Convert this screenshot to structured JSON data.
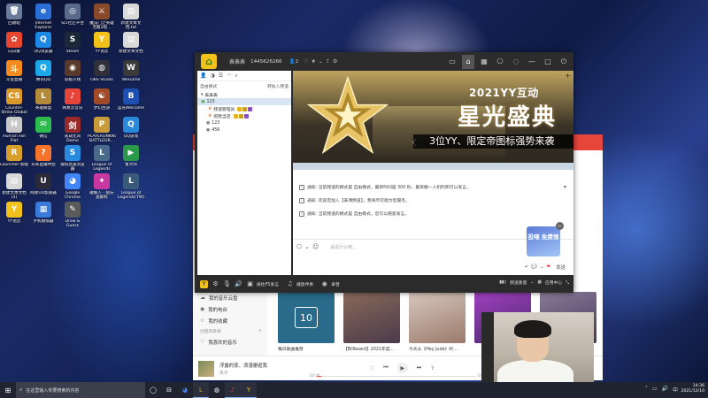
{
  "desktop": {
    "icons": [
      {
        "label": "回收站",
        "glyph": "🗑",
        "color": "#6b7c9a"
      },
      {
        "label": "Internet Explorer",
        "glyph": "e",
        "color": "#2a6fd6"
      },
      {
        "label": "SCI社区平台",
        "glyph": "◎",
        "color": "#5a6a8a"
      },
      {
        "label": "魔法门之英雄无敌3经...",
        "glyph": "⚔",
        "color": "#8a4a2a"
      },
      {
        "label": "新建文本文档.txt",
        "glyph": "▤",
        "color": "#d8d8d8"
      },
      {
        "label": "向日葵",
        "glyph": "✿",
        "color": "#e6452f"
      },
      {
        "label": "QQ浏览器",
        "glyph": "Q",
        "color": "#1e88e5"
      },
      {
        "label": "Steam",
        "glyph": "S",
        "color": "#1b2838"
      },
      {
        "label": "YY语音",
        "glyph": "Y",
        "color": "#f2c21b"
      },
      {
        "label": "新建文本文档",
        "glyph": "▤",
        "color": "#d8d8d8"
      },
      {
        "label": "斗鱼直播",
        "glyph": "斗",
        "color": "#f58a1f"
      },
      {
        "label": "腾讯QQ",
        "glyph": "Q",
        "color": "#1ca7e8"
      },
      {
        "label": "穿越火线",
        "glyph": "◉",
        "color": "#5a3a2a"
      },
      {
        "label": "OBS Studio",
        "glyph": "◍",
        "color": "#30303a"
      },
      {
        "label": "WeGame",
        "glyph": "W",
        "color": "#3a3a3a"
      },
      {
        "label": "Counter-Strike Global Off...",
        "glyph": "CS",
        "color": "#d99a2b"
      },
      {
        "label": "英雄联盟",
        "glyph": "L",
        "color": "#b48a3a"
      },
      {
        "label": "网易云音乐",
        "glyph": "♪",
        "color": "#e6453a"
      },
      {
        "label": "梦幻西游",
        "glyph": "☯",
        "color": "#a04a2a"
      },
      {
        "label": "蓝光Welcome",
        "glyph": "B",
        "color": "#1c4fb0"
      },
      {
        "label": "Human Fall Flat",
        "glyph": "H",
        "color": "#c8c8c8"
      },
      {
        "label": "微信",
        "glyph": "✉",
        "color": "#2dbb4d"
      },
      {
        "label": "永劫无间 Demo",
        "glyph": "剑",
        "color": "#9a2a2a"
      },
      {
        "label": "PLAYERUNKNOWN'S BATTLEGR...",
        "glyph": "P",
        "color": "#c89a3a"
      },
      {
        "label": "QQ游戏",
        "glyph": "Q",
        "color": "#2a88d8"
      },
      {
        "label": "Launcher 新版",
        "glyph": "R",
        "color": "#d8a02a"
      },
      {
        "label": "头条直播伴侣",
        "glyph": "?",
        "color": "#f5732b"
      },
      {
        "label": "搜狗高速浏览器",
        "glyph": "S",
        "color": "#2a8ae0"
      },
      {
        "label": "League of Legends",
        "glyph": "L",
        "color": "#4a6a8a"
      },
      {
        "label": "鲁大师",
        "glyph": "▶",
        "color": "#2a9a4a"
      },
      {
        "label": "新建文本文档 (3)",
        "glyph": "▤",
        "color": "#d8d8d8"
      },
      {
        "label": "网易UU加速器",
        "glyph": "U",
        "color": "#2a2a3a"
      },
      {
        "label": "Google Chrome",
        "glyph": "◕",
        "color": "#4285f4"
      },
      {
        "label": "破解人 - 极乐迪斯科",
        "glyph": "✦",
        "color": "#c838a0"
      },
      {
        "label": "League of Legends(TW)",
        "glyph": "L",
        "color": "#3a5a7a"
      },
      {
        "label": "YY语音",
        "glyph": "Y",
        "color": "#f2c21b"
      },
      {
        "label": "手机模拟器",
        "glyph": "▦",
        "color": "#3a7ad8"
      },
      {
        "label": "Draw & Guess",
        "glyph": "✎",
        "color": "#5a5a5a"
      }
    ]
  },
  "yy": {
    "title_name": "表表表",
    "title_id": "1445626266",
    "title_count": "2",
    "left": {
      "mode_label": "自由模式",
      "mode_right": "转加入频道",
      "channel_root": "表表表",
      "channel_selected": "123",
      "items": [
        {
          "label": "频道管理员"
        },
        {
          "label": "闹我当店"
        },
        {
          "label": "123"
        },
        {
          "label": "456"
        }
      ]
    },
    "banner": {
      "title1": "2021YY互动",
      "title2": "星光盛典",
      "sub": "3位YY、限定帝图标强势来袭"
    },
    "chat": [
      {
        "text": "通知: 当前频道的模式是 自由模式，最早时间是 300 秒，最早撤一人机时即可以发言。"
      },
      {
        "text": "通知: 欢迎您加入【表演频道】，我将尽可能为您服务。"
      },
      {
        "text": "通知: 当前频道的模式是 自由模式，您可以随意发言。"
      }
    ],
    "input_placeholder": "请说什么吧...",
    "input_send": "发送",
    "promo_text": "投喂 免费领",
    "bottom": {
      "ctrl_mic": "按住F5发言",
      "ctrl_play": "播放伴奏",
      "ctrl_record": "录音",
      "right_quality": "频道质量",
      "right_app": "应用中心"
    }
  },
  "music": {
    "sidebar": [
      {
        "label": "我的音乐云盘",
        "icon": "☁"
      },
      {
        "label": "我的电台",
        "icon": "◉"
      },
      {
        "label": "我的收藏",
        "icon": "☆"
      }
    ],
    "group_label": "创建的歌单",
    "playlist_item": "我喜欢的音乐",
    "cards": [
      {
        "title": "每日歌曲推荐",
        "color": "#2a6a8a"
      },
      {
        "title": "【Billboard】2021年度...",
        "color": "#6a4a5a"
      },
      {
        "title": "今天从《Hey Jude》听...",
        "color": "#b89a8a"
      },
      {
        "title": "",
        "color": "#8a3aa0"
      },
      {
        "title": "",
        "color": "#6a5a7a"
      }
    ],
    "daily_num": "10",
    "song": "浮露的夜、浪漫邂逅我",
    "artist": "风子",
    "time_left": "00:06",
    "time_right": "04:22",
    "progress": 0.03
  },
  "taskbar": {
    "search_placeholder": "在这里输入你要搜索的内容",
    "clock_time": "14:36",
    "clock_date": "2021/12/10"
  }
}
